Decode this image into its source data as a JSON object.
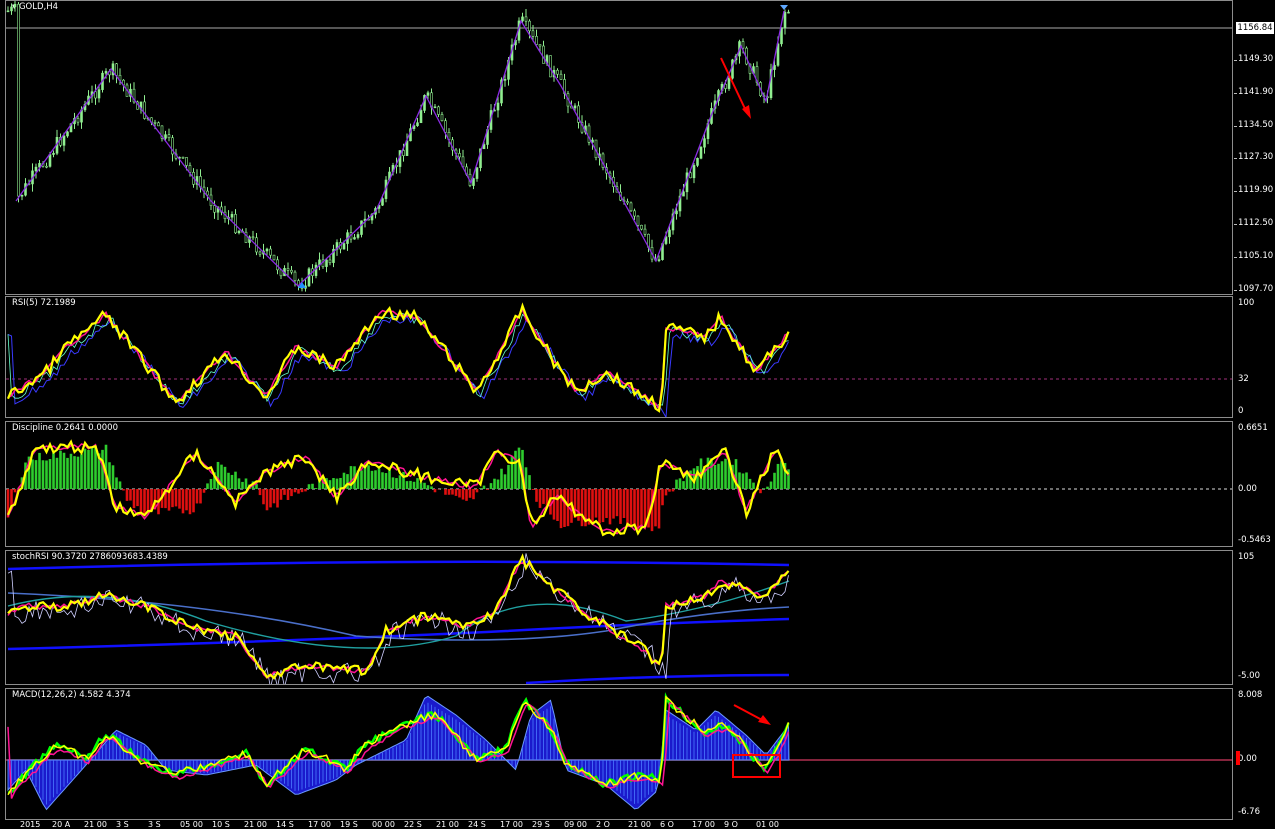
{
  "main_chart": {
    "title": "GOLD,H4",
    "price_ticks": [
      "1149.30",
      "1141.90",
      "1134.50",
      "1127.30",
      "1119.90",
      "1112.50",
      "1105.10",
      "1097.70"
    ],
    "current_price": "1156.84"
  },
  "rsi": {
    "label": "RSI(5) 72.1989",
    "ticks": [
      "100",
      "32",
      "0"
    ]
  },
  "discipline": {
    "label": "Discipline 0.2641 0.0000",
    "ticks": [
      "0.6651",
      "0.00",
      "-0.5463"
    ]
  },
  "stochrsi": {
    "label": "stochRSI 90.3720 2786093683.4389",
    "ticks": [
      "105",
      "-5.00"
    ]
  },
  "macd": {
    "label": "MACD(12,26,2) 4.582 4.374",
    "ticks": [
      "8.008",
      "0.00",
      "-6.76"
    ]
  },
  "time_axis": [
    "2015",
    "20 A",
    "21 00",
    "3 S",
    "3 S",
    "05 00",
    "10 S",
    "21 00",
    "14 S",
    "17 00",
    "19 S",
    "00 00",
    "22 S",
    "21 00",
    "24 S",
    "17 00",
    "29 S",
    "09 00",
    "2 O",
    "21 00",
    "6 O",
    "17 00",
    "9 O",
    "01 00"
  ],
  "colors": {
    "bull_candle": "#90ee90",
    "zigzag": "#8a2be2",
    "yellow": "#ffff00",
    "magenta": "#ff1493",
    "blue": "#1010ff",
    "red": "#ff0000",
    "green": "#00ff00"
  }
}
